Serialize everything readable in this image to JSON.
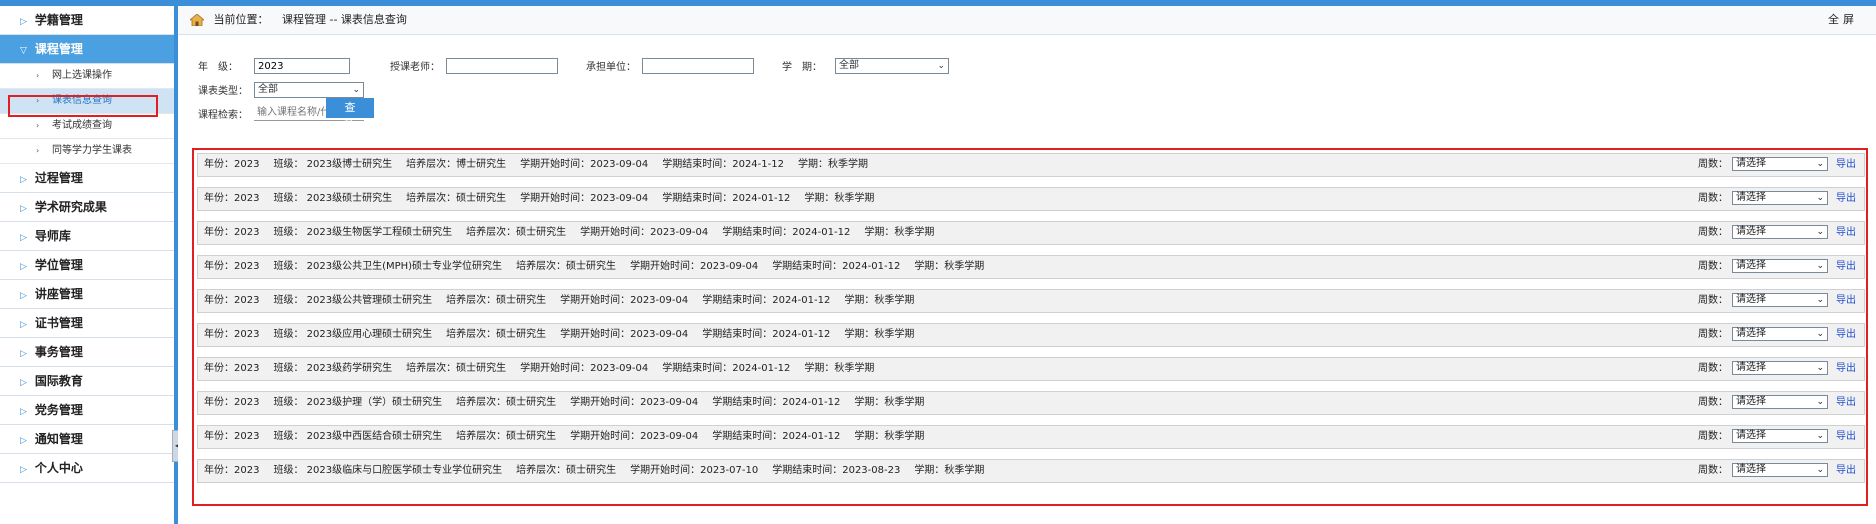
{
  "sidebar": {
    "menu": [
      {
        "label": "学籍管理"
      },
      {
        "label": "课程管理"
      },
      {
        "label": "过程管理"
      },
      {
        "label": "学术研究成果"
      },
      {
        "label": "导师库"
      },
      {
        "label": "学位管理"
      },
      {
        "label": "讲座管理"
      },
      {
        "label": "证书管理"
      },
      {
        "label": "事务管理"
      },
      {
        "label": "国际教育"
      },
      {
        "label": "党务管理"
      },
      {
        "label": "通知管理"
      },
      {
        "label": "个人中心"
      }
    ],
    "submenu": [
      {
        "label": "网上选课操作"
      },
      {
        "label": "课表信息查询"
      },
      {
        "label": "考试成绩查询"
      },
      {
        "label": "同等学力学生课表"
      }
    ]
  },
  "breadcrumb": {
    "label": "当前位置：",
    "path": "课程管理 -- 课表信息查询"
  },
  "fullscreen": "全屏",
  "filters": {
    "grade_label": "年　级：",
    "grade_value": "2023",
    "teacher_label": "授课老师：",
    "teacher_value": "",
    "unit_label": "承担单位：",
    "unit_value": "",
    "term_label": "学　期：",
    "term_value": "全部",
    "type_label": "课表类型：",
    "type_value": "全部",
    "search_label": "课程检索：",
    "search_placeholder": "输入课程名称/代码",
    "search_button": "查询"
  },
  "results": {
    "weeks_label": "周数：",
    "weeks_placeholder": "请选择",
    "export_label": "导出",
    "rows": [
      {
        "year": "年份：2023",
        "class": "班级： 2023级博士研究生",
        "level": "培养层次：博士研究生",
        "start": "学期开始时间：2023-09-04",
        "end": "学期结束时间：2024-1-12",
        "term": "学期：秋季学期"
      },
      {
        "year": "年份：2023",
        "class": "班级： 2023级硕士研究生",
        "level": "培养层次：硕士研究生",
        "start": "学期开始时间：2023-09-04",
        "end": "学期结束时间：2024-01-12",
        "term": "学期：秋季学期"
      },
      {
        "year": "年份：2023",
        "class": "班级： 2023级生物医学工程硕士研究生",
        "level": "培养层次：硕士研究生",
        "start": "学期开始时间：2023-09-04",
        "end": "学期结束时间：2024-01-12",
        "term": "学期：秋季学期"
      },
      {
        "year": "年份：2023",
        "class": "班级： 2023级公共卫生(MPH)硕士专业学位研究生",
        "level": "培养层次：硕士研究生",
        "start": "学期开始时间：2023-09-04",
        "end": "学期结束时间：2024-01-12",
        "term": "学期：秋季学期"
      },
      {
        "year": "年份：2023",
        "class": "班级： 2023级公共管理硕士研究生",
        "level": "培养层次：硕士研究生",
        "start": "学期开始时间：2023-09-04",
        "end": "学期结束时间：2024-01-12",
        "term": "学期：秋季学期"
      },
      {
        "year": "年份：2023",
        "class": "班级： 2023级应用心理硕士研究生",
        "level": "培养层次：硕士研究生",
        "start": "学期开始时间：2023-09-04",
        "end": "学期结束时间：2024-01-12",
        "term": "学期：秋季学期"
      },
      {
        "year": "年份：2023",
        "class": "班级： 2023级药学研究生",
        "level": "培养层次：硕士研究生",
        "start": "学期开始时间：2023-09-04",
        "end": "学期结束时间：2024-01-12",
        "term": "学期：秋季学期"
      },
      {
        "year": "年份：2023",
        "class": "班级： 2023级护理（学）硕士研究生",
        "level": "培养层次：硕士研究生",
        "start": "学期开始时间：2023-09-04",
        "end": "学期结束时间：2024-01-12",
        "term": "学期：秋季学期"
      },
      {
        "year": "年份：2023",
        "class": "班级： 2023级中西医结合硕士研究生",
        "level": "培养层次：硕士研究生",
        "start": "学期开始时间：2023-09-04",
        "end": "学期结束时间：2024-01-12",
        "term": "学期：秋季学期"
      },
      {
        "year": "年份：2023",
        "class": "班级： 2023级临床与口腔医学硕士专业学位研究生",
        "level": "培养层次：硕士研究生",
        "start": "学期开始时间：2023-07-10",
        "end": "学期结束时间：2023-08-23",
        "term": "学期：秋季学期"
      }
    ]
  }
}
